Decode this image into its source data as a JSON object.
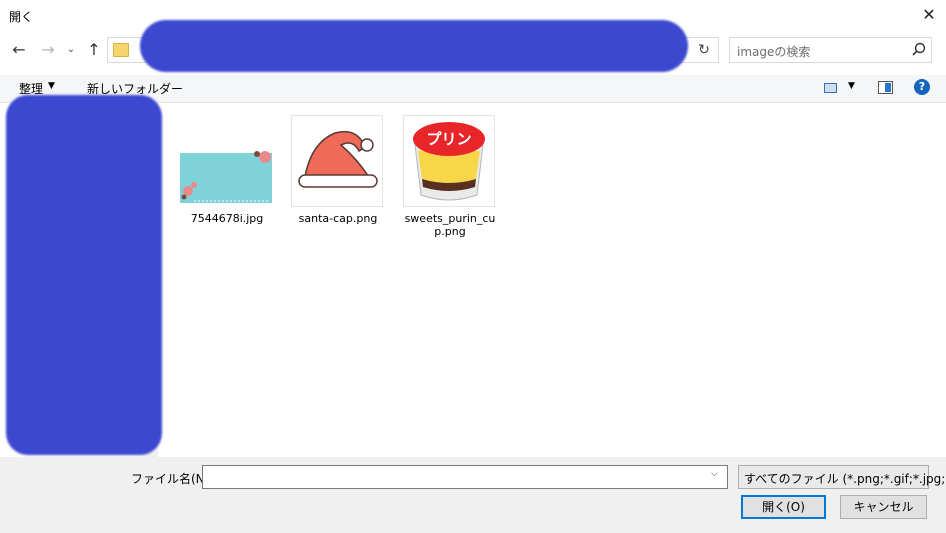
{
  "window": {
    "title": "開く",
    "close_symbol": "✕"
  },
  "nav": {
    "back": "←",
    "forward": "→",
    "recent": "⌄",
    "up": "↑",
    "refresh": "↻"
  },
  "search": {
    "placeholder": "imageの検索"
  },
  "toolbar": {
    "organize": "整理",
    "organize_arrow": "▼",
    "new_folder": "新しいフォルダー",
    "view_arrow": "▼",
    "help": "?"
  },
  "files": [
    {
      "name": "7544678i.jpg",
      "icon": "card-thumbnail"
    },
    {
      "name": "santa-cap.png",
      "icon": "santa-hat-thumbnail"
    },
    {
      "name": "sweets_purin_cup.png",
      "icon": "pudding-thumbnail",
      "badge_text": "プリン"
    }
  ],
  "bottom": {
    "filename_label": "ファイル名(N):",
    "filename_value": "",
    "filter_label": "すべてのファイル (*.png;*.gif;*.jpg;",
    "open_label": "開く(O)",
    "cancel_label": "キャンセル"
  },
  "colors": {
    "accent": "#0078d7",
    "redaction": "#3b48cf"
  }
}
